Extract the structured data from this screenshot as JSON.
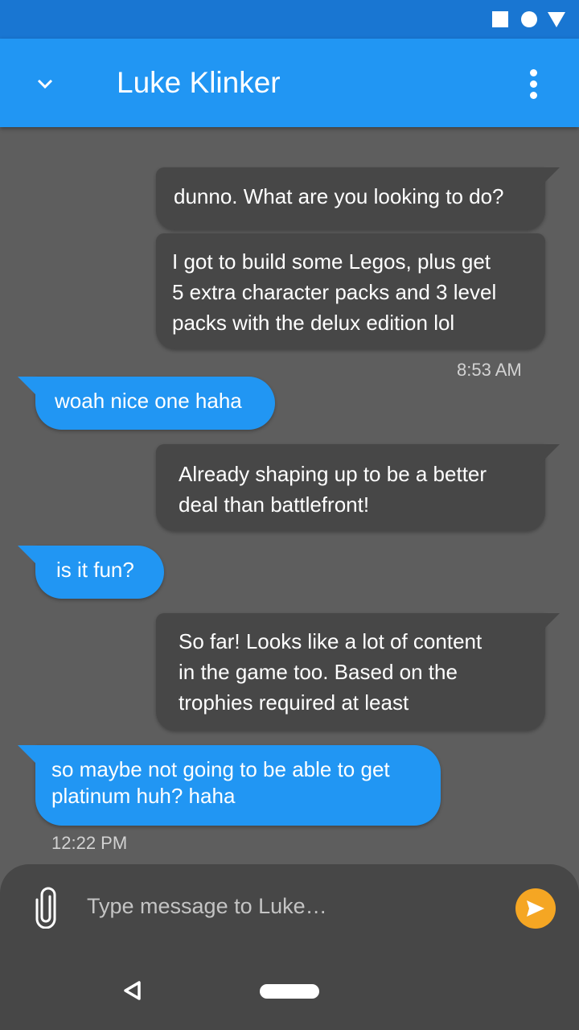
{
  "status_bar": {
    "icons": [
      "square-icon",
      "circle-icon",
      "triangle-icon"
    ]
  },
  "header": {
    "title": "Luke Klinker",
    "collapse_icon": "chevron-down-icon",
    "menu_icon": "more-vert-icon",
    "color": "#2196f3"
  },
  "conversation": {
    "messages": [
      {
        "direction": "sent",
        "text": "dunno. What are you looking to do?"
      },
      {
        "direction": "sent",
        "text": "I got to build some Legos, plus get\n5 extra character packs and 3 level\npacks with the delux edition lol"
      },
      {
        "direction": "received",
        "text": "woah nice one haha"
      },
      {
        "direction": "sent",
        "text": "Already shaping up to be a better\ndeal than battlefront!"
      },
      {
        "direction": "received",
        "text": "is it fun?"
      },
      {
        "direction": "sent",
        "text": "So far! Looks like a lot of content\nin the game too. Based on the\ntrophies required at least"
      },
      {
        "direction": "received",
        "text": "so maybe not going to be able to get\nplatinum huh? haha"
      }
    ],
    "timestamps": {
      "first": "8:53 AM",
      "last": "12:22 PM"
    }
  },
  "composer": {
    "placeholder": "Type message to Luke…",
    "value": "",
    "attach_icon": "paperclip-icon",
    "send_icon": "send-icon",
    "send_color": "#f5a623"
  },
  "nav_bar": {
    "icons": [
      "back-icon",
      "home-icon"
    ]
  }
}
